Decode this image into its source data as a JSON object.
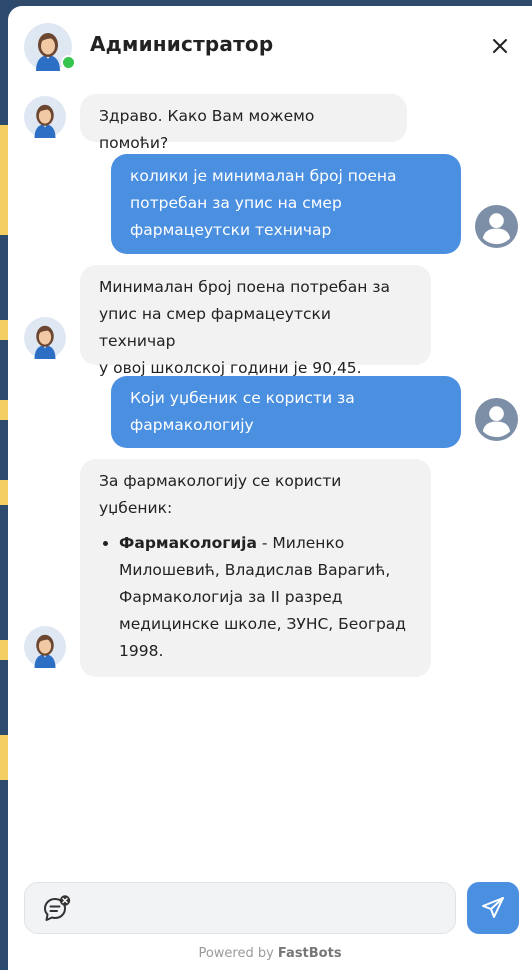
{
  "header": {
    "title": "Администратор",
    "status_color": "#35c44c"
  },
  "messages": [
    {
      "role": "bot",
      "text": "Здраво. Како Вам можемо помоћи?"
    },
    {
      "role": "user",
      "lines": [
        "колики је минималан број поена",
        "потребан за упис на смер",
        "фармацеутски техничар"
      ]
    },
    {
      "role": "bot",
      "lines": [
        "Минималан број поена потребан за",
        "упис на смер фармацеутски техничар",
        "у овој школској години је 90,45."
      ]
    },
    {
      "role": "user",
      "lines": [
        "Који уџбеник се користи за",
        "фармакологију"
      ]
    },
    {
      "role": "bot",
      "lines": [
        "За фармакологију се користи",
        "уџбеник:"
      ],
      "list_bold": "Фармакологија",
      "list_lines": [
        " - Миленко",
        "Милошевић, Владислав Варагић,",
        "Фармакологија за II разред",
        "медицинске школе, ЗУНС, Београд",
        "1998."
      ]
    }
  ],
  "input": {
    "placeholder": "",
    "value": ""
  },
  "footer": {
    "powered_prefix": "Powered by ",
    "brand": "FastBots"
  },
  "colors": {
    "accent": "#4a8fe0",
    "bot_bubble": "#f2f2f2",
    "user_avatar": "#7d8fa6"
  },
  "icons": {
    "close": "close-icon",
    "chat": "chat-bubble-icon",
    "send": "send-icon",
    "user_avatar": "user-avatar-icon",
    "bot_avatar": "bot-avatar-icon"
  }
}
